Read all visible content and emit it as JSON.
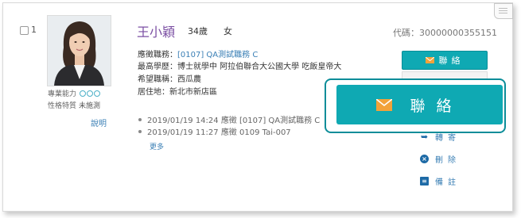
{
  "candidate": {
    "index": "1",
    "name": "王小穎",
    "age": "34歲",
    "gender": "女",
    "code": "代碼：30000000355151",
    "applied_label": "應徵職務：",
    "applied_job": "[0107] QA測試職務 C",
    "education": "最高學歷：博士就學中 阿拉伯聯合大公國大學 吃飯皇帝大",
    "desired_title": "希望職稱：西瓜農",
    "residence": "居住地：新北市新店區"
  },
  "profile": {
    "skill_label": "專業能力",
    "personality_label": "性格特質",
    "personality_value": "未施測",
    "explain_link": "說明"
  },
  "applications": [
    {
      "text": "2019/01/19 14:24 應徵 [0107] QA測試職務 C"
    },
    {
      "text": "2019/01/19 11:27 應徵 0109 Tai-007"
    }
  ],
  "more_link": "更多",
  "actions": {
    "contact_label": "聯絡",
    "forward_label": "轉寄",
    "delete_label": "刪除",
    "note_label": "備註"
  },
  "colors": {
    "accent": "#0fa9b3",
    "callout_border": "#0b8d99",
    "name": "#7b4fa3",
    "link": "#3a7fb5",
    "envelope": "#f2a23a"
  },
  "icons": [
    "envelope-icon",
    "forward-icon",
    "delete-icon",
    "note-icon",
    "list-icon"
  ]
}
